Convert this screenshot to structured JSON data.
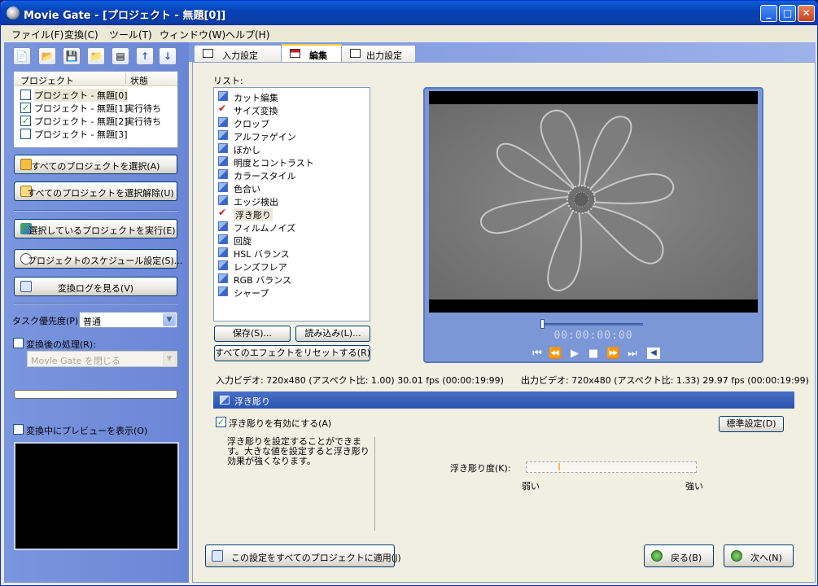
{
  "window": {
    "title": "Movie Gate - [プロジェクト - 無題[0]]"
  },
  "menu": [
    "ファイル(F)",
    "変換(C)",
    "ツール(T)",
    "ウィンドウ(W)",
    "ヘルプ(H)"
  ],
  "toolbar_icons": [
    "new-file-icon",
    "open-folder-icon",
    "save-icon",
    "folder-icon",
    "properties-icon",
    "arrow-up-icon",
    "arrow-down-icon"
  ],
  "projects": {
    "col_name": "プロジェクト",
    "col_status": "状態",
    "rows": [
      {
        "name": "プロジェクト - 無題[0]",
        "status": "",
        "checked": false
      },
      {
        "name": "プロジェクト - 無題[1]",
        "status": "実行待ち",
        "checked": true
      },
      {
        "name": "プロジェクト - 無題[2]",
        "status": "実行待ち",
        "checked": true
      },
      {
        "name": "プロジェクト - 無題[3]",
        "status": "",
        "checked": false
      }
    ]
  },
  "left": {
    "select_all": "すべてのプロジェクトを選択(A)",
    "deselect_all": "すべてのプロジェクトを選択解除(U)",
    "run_selected": "選択しているプロジェクトを実行(E)",
    "schedule": "プロジェクトのスケジュール設定(S)...",
    "view_log": "変換ログを見る(V)",
    "task_priority_label": "タスク優先度(P):",
    "task_priority_value": "普通",
    "post_process_label": "変換後の処理(R):",
    "post_process_value": "Movie Gate を閉じる",
    "preview_label": "変換中にプレビューを表示(O)",
    "progress": 0
  },
  "tabs": [
    {
      "label": "入力設定",
      "active": false
    },
    {
      "label": "編集",
      "active": true
    },
    {
      "label": "出力設定",
      "active": false
    }
  ],
  "edit": {
    "list_label": "リスト:",
    "effects": [
      {
        "label": "カット編集",
        "checked": false
      },
      {
        "label": "サイズ変換",
        "checked": true
      },
      {
        "label": "クロップ",
        "checked": false
      },
      {
        "label": "アルファゲイン",
        "checked": false
      },
      {
        "label": "ぼかし",
        "checked": false
      },
      {
        "label": "明度とコントラスト",
        "checked": false
      },
      {
        "label": "カラースタイル",
        "checked": false
      },
      {
        "label": "色合い",
        "checked": false
      },
      {
        "label": "エッジ検出",
        "checked": false
      },
      {
        "label": "浮き彫り",
        "checked": true,
        "selected": true
      },
      {
        "label": "フィルムノイズ",
        "checked": false
      },
      {
        "label": "回旋",
        "checked": false
      },
      {
        "label": "HSL バランス",
        "checked": false
      },
      {
        "label": "レンズフレア",
        "checked": false
      },
      {
        "label": "RGB バランス",
        "checked": false
      },
      {
        "label": "シャープ",
        "checked": false
      }
    ],
    "save_btn": "保存(S)...",
    "load_btn": "読み込み(L)...",
    "reset_btn": "すべてのエフェクトをリセットする(R)",
    "timecode": "00:00:00:00",
    "input_info": "入力ビデオ: 720x480 (アスペクト比: 1.00) 30.01 fps (00:00:19:99)",
    "output_info": "出力ビデオ: 720x480 (アスペクト比: 1.33) 29.97 fps (00:00:19:99)",
    "section_title": "浮き彫り",
    "enable_label": "浮き彫りを有効にする(A)",
    "enable_checked": true,
    "default_btn": "標準設定(D)",
    "description": "浮き彫りを設定することができます。大きな値を設定すると浮き彫り効果が強くなります。",
    "degree_label": "浮き彫り度(K):",
    "weak_label": "弱い",
    "strong_label": "強い",
    "degree_value": 0.2,
    "apply_all_btn": "この設定をすべてのプロジェクトに適用(J)",
    "back_btn": "戻る(B)",
    "next_btn": "次へ(N)"
  },
  "colors": {
    "title_bar": "#0842b8",
    "left_panel": "#7a96df",
    "section_head": "#2a52b0",
    "check": "#21a121",
    "fx_check": "#d01010"
  }
}
